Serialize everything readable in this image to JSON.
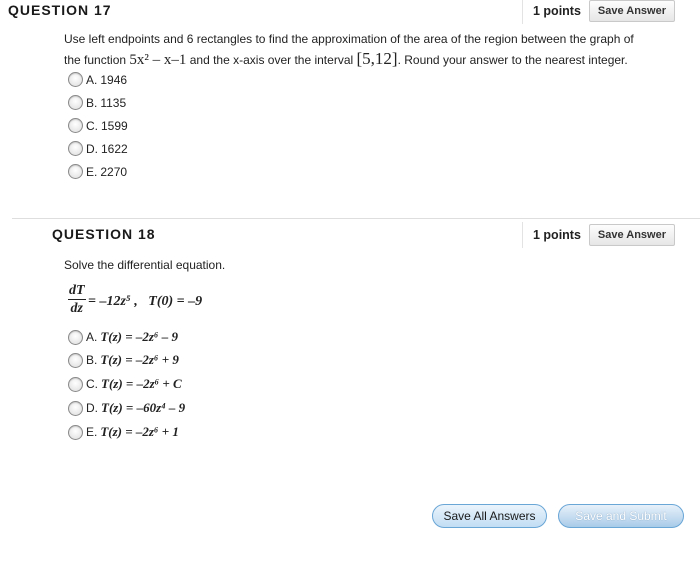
{
  "questions": [
    {
      "title": "QUESTION 17",
      "points": "1 points",
      "save_label": "Save Answer",
      "text_line1": "Use left endpoints and 6 rectangles to find the approximation of the area of the region between the graph of",
      "text_line2_pre": "the function",
      "text_line2_math": "5x² – x–1",
      "text_line2_mid": "and the x-axis over the interval",
      "text_line2_interval": "[5,12]",
      "text_line2_post": ". Round your answer to the nearest integer.",
      "choices": [
        {
          "letter": "A.",
          "value": "1946"
        },
        {
          "letter": "B.",
          "value": "1135"
        },
        {
          "letter": "C.",
          "value": "1599"
        },
        {
          "letter": "D.",
          "value": "1622"
        },
        {
          "letter": "E.",
          "value": "2270"
        }
      ]
    },
    {
      "title": "QUESTION 18",
      "points": "1 points",
      "save_label": "Save Answer",
      "text": "Solve the differential equation.",
      "eq_num": "dT",
      "eq_den": "dz",
      "eq_rhs": "= –12z⁵ ,   T(0) = –9",
      "choices": [
        {
          "letter": "A.",
          "value": "T(z) = –2z⁶ – 9"
        },
        {
          "letter": "B.",
          "value": "T(z) = –2z⁶ + 9"
        },
        {
          "letter": "C.",
          "value": "T(z) = –2z⁶ + C"
        },
        {
          "letter": "D.",
          "value": "T(z) = –60z⁴ – 9"
        },
        {
          "letter": "E.",
          "value": "T(z) = –2z⁶ + 1"
        }
      ]
    }
  ],
  "footer": {
    "save_all_label": "Save All Answers",
    "save_submit_label": "Save and Submit"
  }
}
